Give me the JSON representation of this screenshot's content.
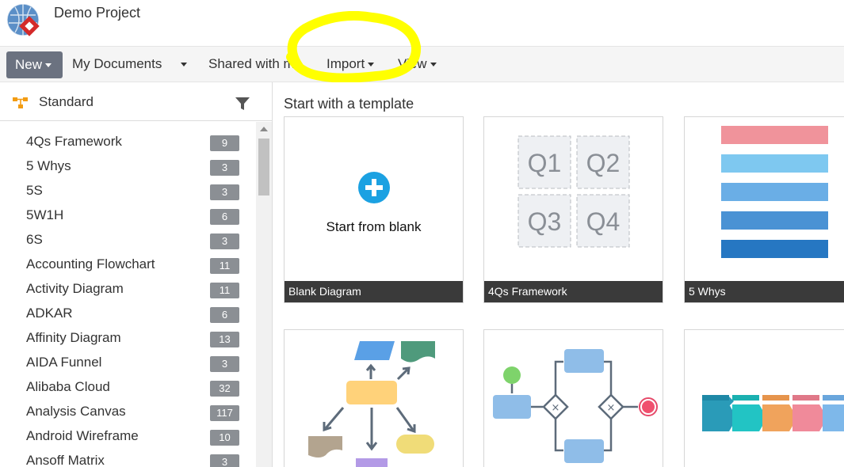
{
  "header": {
    "project_title": "Demo Project"
  },
  "toolbar": {
    "new_label": "New",
    "my_documents_label": "My Documents",
    "shared_label": "Shared with me",
    "import_label": "Import",
    "view_label": "View"
  },
  "sidebar": {
    "category_label": "Standard",
    "items": [
      {
        "label": "4Qs Framework",
        "count": "9"
      },
      {
        "label": "5 Whys",
        "count": "3"
      },
      {
        "label": "5S",
        "count": "3"
      },
      {
        "label": "5W1H",
        "count": "6"
      },
      {
        "label": "6S",
        "count": "3"
      },
      {
        "label": "Accounting Flowchart",
        "count": "11"
      },
      {
        "label": "Activity Diagram",
        "count": "11"
      },
      {
        "label": "ADKAR",
        "count": "6"
      },
      {
        "label": "Affinity Diagram",
        "count": "13"
      },
      {
        "label": "AIDA Funnel",
        "count": "3"
      },
      {
        "label": "Alibaba Cloud",
        "count": "32"
      },
      {
        "label": "Analysis Canvas",
        "count": "117"
      },
      {
        "label": "Android Wireframe",
        "count": "10"
      },
      {
        "label": "Ansoff Matrix",
        "count": "3"
      }
    ]
  },
  "main": {
    "section_title": "Start with a template",
    "blank_card_text": "Start from blank",
    "cards": [
      {
        "caption": "Blank Diagram"
      },
      {
        "caption": "4Qs Framework",
        "quadrants": [
          "Q1",
          "Q2",
          "Q3",
          "Q4"
        ]
      },
      {
        "caption": "5 Whys"
      }
    ]
  },
  "colors": {
    "accent": "#1ba1e2",
    "new_button": "#6b7280",
    "highlight": "#ffff00",
    "caption_bar": "#3a3a3a",
    "badge": "#8b8f94"
  }
}
